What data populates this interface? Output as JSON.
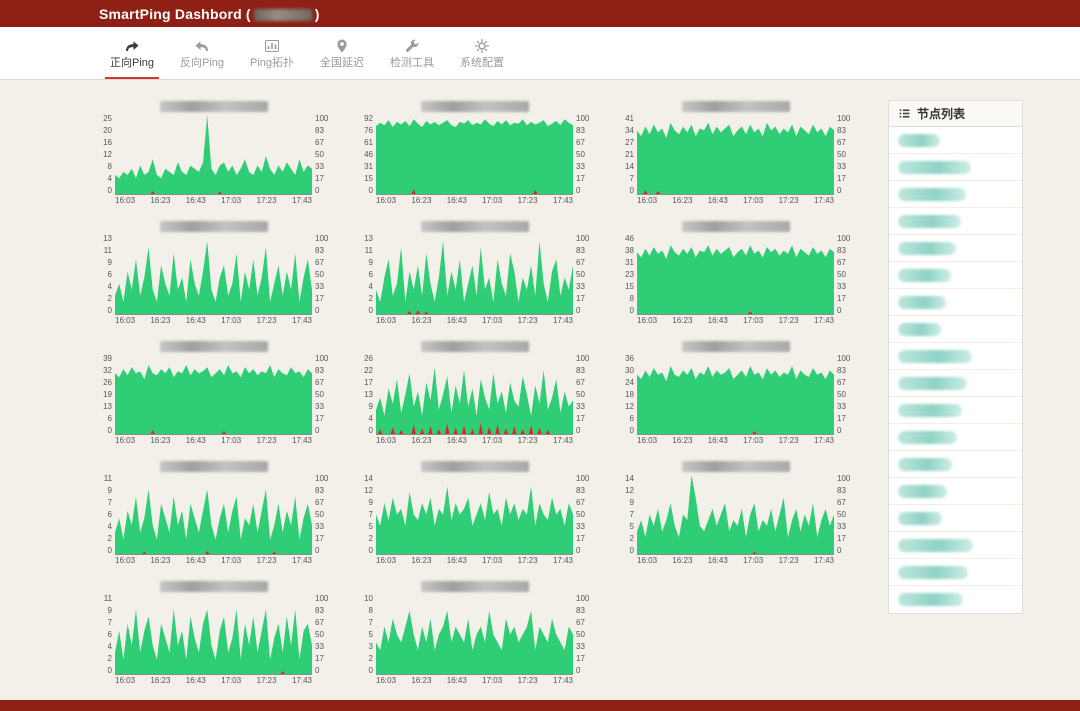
{
  "header": {
    "title_prefix": "SmartPing Dashbord (",
    "title_suffix": ")",
    "title_redacted": true
  },
  "nav": {
    "tabs": [
      {
        "id": "forward-ping",
        "label": "正向Ping",
        "icon": "forward-arrow",
        "active": true
      },
      {
        "id": "reverse-ping",
        "label": "反向Ping",
        "icon": "back-arrow",
        "active": false
      },
      {
        "id": "ping-topology",
        "label": "Ping拓扑",
        "icon": "bar-chart",
        "active": false
      },
      {
        "id": "national-latency",
        "label": "全国延迟",
        "icon": "location-pin",
        "active": false
      },
      {
        "id": "detection-tools",
        "label": "检测工具",
        "icon": "wrench",
        "active": false
      },
      {
        "id": "system-config",
        "label": "系统配置",
        "icon": "gear",
        "active": false
      }
    ]
  },
  "sidebar": {
    "title": "节点列表",
    "icon": "list",
    "nodes": [
      {
        "redacted": true
      },
      {
        "redacted": true
      },
      {
        "redacted": true
      },
      {
        "redacted": true
      },
      {
        "redacted": true
      },
      {
        "redacted": true
      },
      {
        "redacted": true
      },
      {
        "redacted": true
      },
      {
        "redacted": true
      },
      {
        "redacted": true
      },
      {
        "redacted": true
      },
      {
        "redacted": true
      },
      {
        "redacted": true
      },
      {
        "redacted": true
      },
      {
        "redacted": true
      },
      {
        "redacted": true
      },
      {
        "redacted": true
      },
      {
        "redacted": true
      }
    ]
  },
  "colors": {
    "header_bg": "#8f2016",
    "footer_bg": "#8f2016",
    "page_bg": "#f3f0e9",
    "nav_bg": "#ffffff",
    "active_tab_underline": "#d0382b",
    "tab_inactive": "#9b9b9b",
    "tab_active": "#3c3c3c",
    "chart_green": "#2fce76",
    "loss_red": "#e0261c",
    "axis_text": "#555555",
    "panel_border": "#e2ded6",
    "node_pill_teal": "#9ed9ce",
    "redact_gray": "#bdbdbd"
  },
  "chart_data": {
    "type": "area",
    "x_ticks": [
      "16:03",
      "16:23",
      "16:43",
      "17:03",
      "17:23",
      "17:43"
    ],
    "y_right_ticks": [
      100,
      83,
      67,
      50,
      33,
      17,
      0
    ],
    "charts": [
      {
        "title_redacted": true,
        "ylim": [
          0,
          25
        ],
        "y_left_ticks": [
          25,
          20,
          16,
          12,
          8,
          4,
          0
        ],
        "values": [
          6,
          5,
          7,
          6,
          8,
          5,
          9,
          6,
          7,
          11,
          6,
          5,
          8,
          7,
          6,
          10,
          7,
          6,
          9,
          8,
          7,
          10,
          25,
          8,
          6,
          9,
          10,
          7,
          9,
          6,
          8,
          11,
          7,
          6,
          9,
          7,
          12,
          8,
          6,
          9,
          7,
          10,
          8,
          6,
          11,
          7,
          9,
          8
        ],
        "loss": [
          {
            "i": 9,
            "v": 4
          },
          {
            "i": 25,
            "v": 3
          }
        ]
      },
      {
        "title_redacted": true,
        "ylim": [
          0,
          92
        ],
        "y_left_ticks": [
          92,
          76,
          61,
          46,
          31,
          15,
          0
        ],
        "values": [
          79,
          83,
          80,
          86,
          78,
          84,
          81,
          85,
          79,
          87,
          82,
          78,
          85,
          81,
          84,
          80,
          83,
          86,
          80,
          78,
          84,
          82,
          86,
          80,
          83,
          81,
          87,
          82,
          79,
          85,
          81,
          86,
          80,
          83,
          82,
          87,
          80,
          84,
          81,
          83,
          86,
          79,
          82,
          85,
          80,
          87,
          83,
          80
        ],
        "loss": [
          {
            "i": 9,
            "v": 6
          },
          {
            "i": 38,
            "v": 5
          }
        ]
      },
      {
        "title_redacted": true,
        "ylim": [
          0,
          41
        ],
        "y_left_ticks": [
          41,
          34,
          27,
          21,
          14,
          7,
          0
        ],
        "values": [
          33,
          30,
          35,
          31,
          36,
          32,
          34,
          29,
          37,
          33,
          31,
          35,
          32,
          36,
          30,
          34,
          33,
          37,
          31,
          35,
          32,
          34,
          36,
          30,
          33,
          35,
          31,
          36,
          32,
          34,
          30,
          37,
          33,
          35,
          31,
          34,
          32,
          36,
          30,
          35,
          33,
          31,
          36,
          32,
          34,
          30,
          35,
          33
        ],
        "loss": [
          {
            "i": 2,
            "v": 5
          },
          {
            "i": 5,
            "v": 4
          }
        ]
      },
      {
        "title_redacted": true,
        "ylim": [
          0,
          13
        ],
        "y_left_ticks": [
          13,
          11,
          9,
          6,
          4,
          2,
          0
        ],
        "values": [
          3,
          5,
          2,
          7,
          4,
          9,
          3,
          6,
          11,
          4,
          2,
          8,
          5,
          3,
          10,
          4,
          6,
          2,
          9,
          5,
          3,
          7,
          12,
          4,
          2,
          6,
          8,
          3,
          5,
          10,
          2,
          7,
          4,
          9,
          3,
          6,
          11,
          2,
          5,
          8,
          3,
          7,
          4,
          10,
          2,
          6,
          9,
          4
        ],
        "loss": []
      },
      {
        "title_redacted": true,
        "ylim": [
          0,
          13
        ],
        "y_left_ticks": [
          13,
          11,
          9,
          6,
          4,
          2,
          0
        ],
        "values": [
          4,
          2,
          6,
          9,
          3,
          5,
          11,
          2,
          7,
          4,
          8,
          3,
          10,
          5,
          2,
          6,
          12,
          3,
          7,
          4,
          9,
          2,
          5,
          8,
          3,
          11,
          4,
          6,
          2,
          9,
          5,
          3,
          10,
          7,
          2,
          6,
          4,
          8,
          3,
          12,
          5,
          2,
          7,
          9,
          3,
          6,
          4,
          8
        ],
        "loss": [
          {
            "i": 8,
            "v": 4
          },
          {
            "i": 10,
            "v": 5
          },
          {
            "i": 12,
            "v": 3
          }
        ]
      },
      {
        "title_redacted": true,
        "ylim": [
          0,
          46
        ],
        "y_left_ticks": [
          46,
          38,
          31,
          23,
          15,
          8,
          0
        ],
        "values": [
          36,
          33,
          38,
          34,
          39,
          35,
          37,
          32,
          40,
          36,
          34,
          38,
          35,
          39,
          33,
          37,
          36,
          40,
          34,
          38,
          35,
          37,
          39,
          33,
          36,
          38,
          34,
          40,
          35,
          37,
          33,
          39,
          36,
          38,
          34,
          37,
          35,
          40,
          33,
          38,
          36,
          34,
          39,
          35,
          37,
          33,
          38,
          36
        ],
        "loss": [
          {
            "i": 27,
            "v": 4
          }
        ]
      },
      {
        "title_redacted": true,
        "ylim": [
          0,
          39
        ],
        "y_left_ticks": [
          39,
          32,
          26,
          19,
          13,
          6,
          0
        ],
        "values": [
          30,
          28,
          32,
          29,
          33,
          30,
          31,
          27,
          34,
          30,
          29,
          32,
          30,
          33,
          28,
          31,
          30,
          34,
          29,
          32,
          30,
          31,
          33,
          28,
          30,
          32,
          29,
          34,
          30,
          31,
          28,
          33,
          30,
          32,
          29,
          31,
          30,
          34,
          28,
          32,
          30,
          29,
          33,
          30,
          31,
          28,
          32,
          30
        ],
        "loss": [
          {
            "i": 9,
            "v": 5
          },
          {
            "i": 26,
            "v": 4
          }
        ]
      },
      {
        "title_redacted": true,
        "ylim": [
          0,
          26
        ],
        "y_left_ticks": [
          26,
          22,
          17,
          13,
          9,
          4,
          0
        ],
        "values": [
          8,
          12,
          6,
          15,
          10,
          18,
          7,
          13,
          20,
          9,
          14,
          6,
          17,
          11,
          22,
          8,
          13,
          19,
          7,
          16,
          10,
          21,
          9,
          15,
          6,
          18,
          12,
          8,
          20,
          10,
          14,
          7,
          17,
          11,
          9,
          19,
          13,
          6,
          16,
          10,
          21,
          8,
          12,
          18,
          7,
          14,
          9,
          11
        ],
        "loss": [
          {
            "i": 1,
            "v": 6
          },
          {
            "i": 4,
            "v": 9
          },
          {
            "i": 6,
            "v": 5
          },
          {
            "i": 9,
            "v": 12
          },
          {
            "i": 11,
            "v": 7
          },
          {
            "i": 13,
            "v": 10
          },
          {
            "i": 15,
            "v": 6
          },
          {
            "i": 17,
            "v": 13
          },
          {
            "i": 19,
            "v": 8
          },
          {
            "i": 21,
            "v": 11
          },
          {
            "i": 23,
            "v": 6
          },
          {
            "i": 25,
            "v": 14
          },
          {
            "i": 27,
            "v": 9
          },
          {
            "i": 29,
            "v": 12
          },
          {
            "i": 31,
            "v": 7
          },
          {
            "i": 33,
            "v": 10
          },
          {
            "i": 35,
            "v": 6
          },
          {
            "i": 37,
            "v": 11
          },
          {
            "i": 39,
            "v": 8
          },
          {
            "i": 41,
            "v": 5
          }
        ]
      },
      {
        "title_redacted": true,
        "ylim": [
          0,
          36
        ],
        "y_left_ticks": [
          36,
          30,
          24,
          18,
          12,
          6,
          0
        ],
        "values": [
          27,
          25,
          29,
          26,
          30,
          27,
          28,
          24,
          31,
          27,
          26,
          29,
          27,
          30,
          25,
          28,
          27,
          31,
          26,
          29,
          27,
          28,
          30,
          25,
          27,
          29,
          26,
          31,
          27,
          28,
          25,
          30,
          27,
          29,
          26,
          28,
          27,
          31,
          25,
          29,
          27,
          26,
          30,
          27,
          28,
          25,
          29,
          27
        ],
        "loss": [
          {
            "i": 28,
            "v": 4
          }
        ]
      },
      {
        "title_redacted": true,
        "ylim": [
          0,
          11
        ],
        "y_left_ticks": [
          11,
          9,
          7,
          6,
          4,
          2,
          0
        ],
        "values": [
          3,
          5,
          2,
          6,
          4,
          8,
          3,
          5,
          9,
          4,
          2,
          7,
          5,
          3,
          8,
          4,
          6,
          2,
          7,
          5,
          3,
          6,
          9,
          4,
          2,
          5,
          7,
          3,
          6,
          8,
          2,
          5,
          4,
          7,
          3,
          6,
          9,
          2,
          4,
          7,
          3,
          6,
          4,
          8,
          2,
          5,
          7,
          4
        ],
        "loss": [
          {
            "i": 7,
            "v": 3
          },
          {
            "i": 22,
            "v": 4
          },
          {
            "i": 38,
            "v": 3
          }
        ]
      },
      {
        "title_redacted": true,
        "ylim": [
          0,
          14
        ],
        "y_left_ticks": [
          14,
          12,
          9,
          7,
          5,
          2,
          0
        ],
        "values": [
          7,
          5,
          9,
          6,
          10,
          7,
          8,
          5,
          11,
          7,
          6,
          9,
          7,
          10,
          5,
          8,
          7,
          12,
          6,
          9,
          7,
          8,
          10,
          5,
          7,
          9,
          6,
          11,
          7,
          8,
          5,
          10,
          7,
          9,
          6,
          8,
          7,
          12,
          5,
          9,
          7,
          6,
          10,
          7,
          8,
          5,
          9,
          7
        ],
        "loss": []
      },
      {
        "title_redacted": true,
        "ylim": [
          0,
          14
        ],
        "y_left_ticks": [
          14,
          12,
          9,
          7,
          5,
          2,
          0
        ],
        "values": [
          4,
          6,
          3,
          7,
          5,
          8,
          4,
          6,
          9,
          5,
          3,
          7,
          6,
          14,
          10,
          5,
          4,
          6,
          8,
          5,
          7,
          9,
          4,
          6,
          5,
          8,
          3,
          7,
          9,
          4,
          6,
          5,
          8,
          4,
          7,
          10,
          3,
          6,
          8,
          4,
          7,
          5,
          9,
          3,
          6,
          8,
          5,
          7
        ],
        "loss": [
          {
            "i": 28,
            "v": 3
          }
        ]
      },
      {
        "title_redacted": true,
        "ylim": [
          0,
          11
        ],
        "y_left_ticks": [
          11,
          9,
          7,
          6,
          4,
          2,
          0
        ],
        "values": [
          3,
          6,
          2,
          7,
          4,
          9,
          3,
          6,
          8,
          4,
          2,
          7,
          5,
          3,
          9,
          4,
          6,
          2,
          8,
          5,
          3,
          7,
          9,
          4,
          2,
          6,
          8,
          3,
          5,
          9,
          2,
          7,
          4,
          8,
          3,
          6,
          9,
          2,
          5,
          7,
          3,
          8,
          4,
          9,
          2,
          6,
          7,
          4
        ],
        "loss": [
          {
            "i": 40,
            "v": 4
          }
        ]
      },
      {
        "title_redacted": true,
        "ylim": [
          0,
          10
        ],
        "y_left_ticks": [
          10,
          8,
          7,
          5,
          3,
          2,
          0
        ],
        "values": [
          4,
          3,
          6,
          4,
          7,
          5,
          4,
          6,
          8,
          5,
          3,
          6,
          4,
          7,
          3,
          5,
          6,
          8,
          4,
          6,
          5,
          4,
          7,
          3,
          5,
          6,
          4,
          8,
          5,
          4,
          3,
          7,
          5,
          6,
          4,
          5,
          6,
          8,
          3,
          6,
          5,
          4,
          7,
          5,
          4,
          3,
          6,
          5
        ],
        "loss": []
      }
    ]
  }
}
